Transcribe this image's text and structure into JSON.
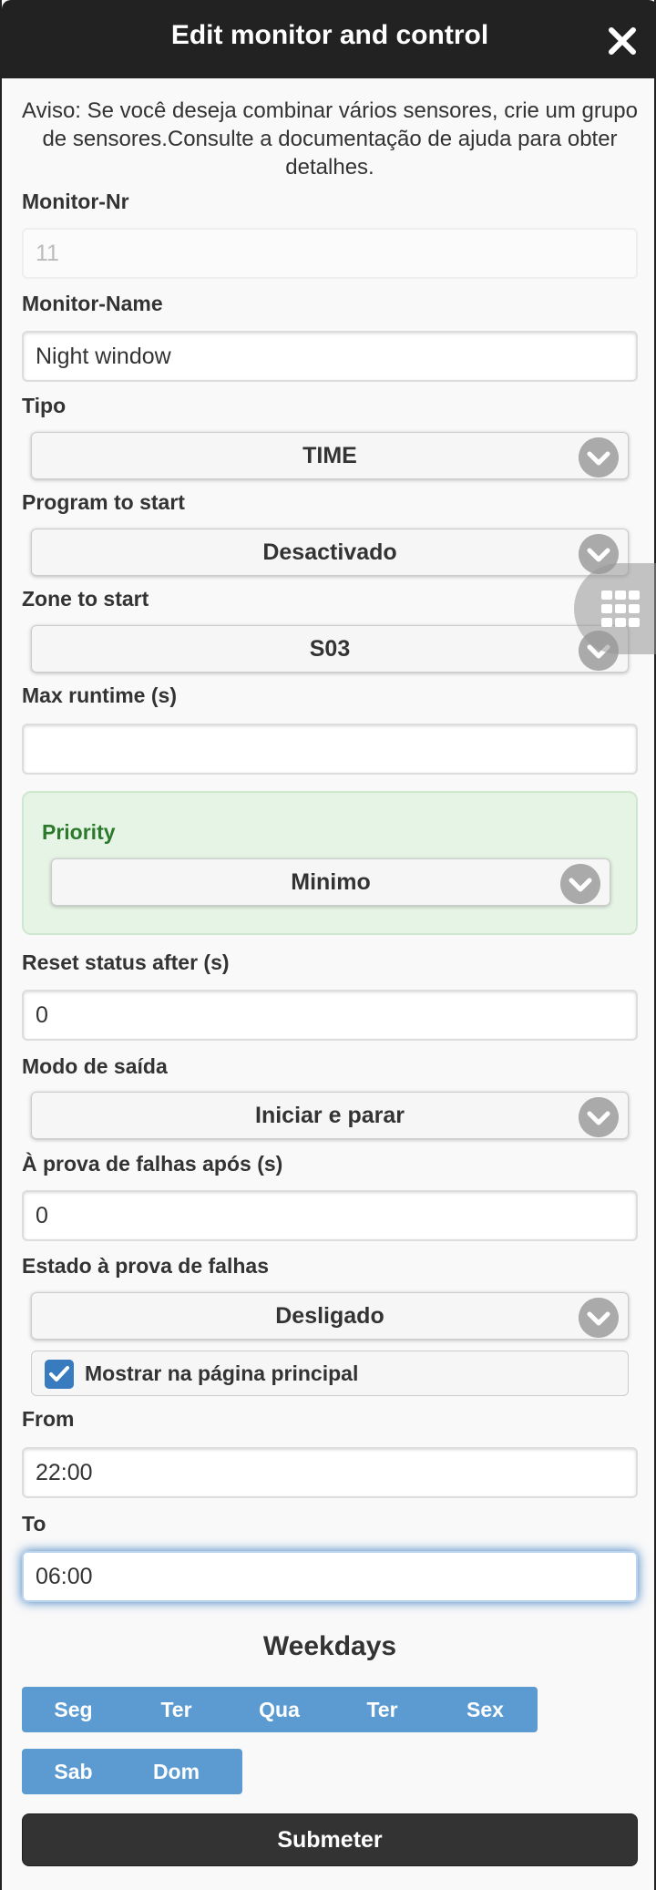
{
  "header": {
    "title": "Edit monitor and control",
    "close_icon": "close-icon"
  },
  "notice": "Aviso: Se você deseja combinar vários sensores, crie um grupo de sensores.Consulte a documentação de ajuda para obter detalhes.",
  "fields": {
    "monitor_nr": {
      "label": "Monitor-Nr",
      "placeholder": "11"
    },
    "monitor_name": {
      "label": "Monitor-Name",
      "value": "Night window"
    },
    "tipo": {
      "label": "Tipo",
      "value": "TIME"
    },
    "program": {
      "label": "Program to start",
      "value": "Desactivado"
    },
    "zone": {
      "label": "Zone to start",
      "value": "S03"
    },
    "max_runtime": {
      "label": "Max runtime (s)",
      "value": ""
    },
    "priority": {
      "label": "Priority",
      "value": "Minimo"
    },
    "reset_status": {
      "label": "Reset status after (s)",
      "value": "0"
    },
    "output_mode": {
      "label": "Modo de saída",
      "value": "Iniciar e parar"
    },
    "failsafe_after": {
      "label": "À prova de falhas após (s)",
      "value": "0"
    },
    "failsafe_state": {
      "label": "Estado à prova de falhas",
      "value": "Desligado"
    },
    "show_main": {
      "label": "Mostrar na página principal",
      "checked": true
    },
    "from": {
      "label": "From",
      "value": "22:00"
    },
    "to": {
      "label": "To",
      "value": "06:00"
    }
  },
  "weekdays": {
    "title": "Weekdays",
    "days": [
      "Seg",
      "Ter",
      "Qua",
      "Ter",
      "Sex",
      "Sab",
      "Dom"
    ]
  },
  "submit_label": "Submeter",
  "colors": {
    "header": "#222222",
    "accent": "#5b9bd1",
    "priority_bg": "#e6f4e6",
    "priority_text": "#2b7a2b"
  }
}
